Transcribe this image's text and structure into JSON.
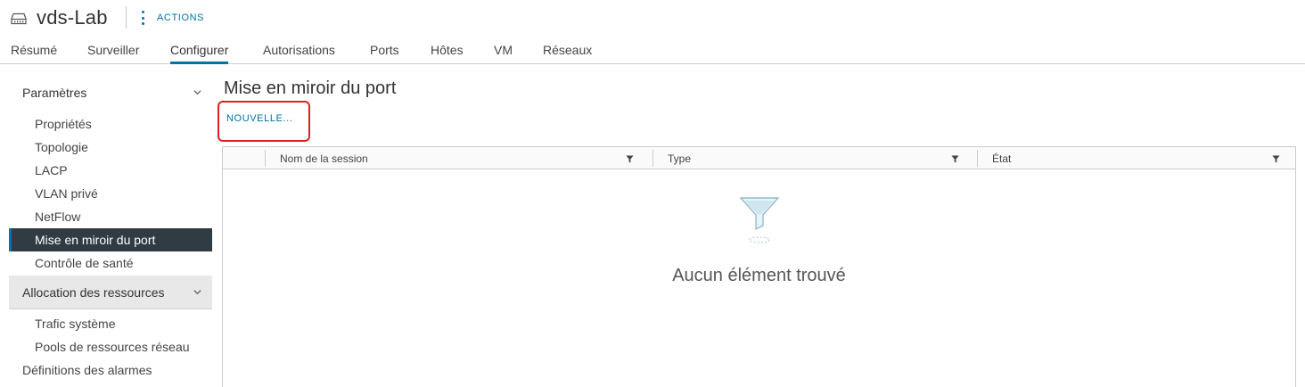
{
  "header": {
    "title": "vds-Lab",
    "object_icon": "switch-icon",
    "actions_label": "ACTIONS"
  },
  "tabs": [
    {
      "label": "Résumé"
    },
    {
      "label": "Surveiller"
    },
    {
      "label": "Configurer",
      "active": true
    },
    {
      "label": "Autorisations"
    },
    {
      "label": "Ports"
    },
    {
      "label": "Hôtes"
    },
    {
      "label": "VM"
    },
    {
      "label": "Réseaux"
    }
  ],
  "sidebar": {
    "section1": {
      "label": "Paramètres",
      "items": [
        {
          "label": "Propriétés"
        },
        {
          "label": "Topologie"
        },
        {
          "label": "LACP"
        },
        {
          "label": "VLAN privé"
        },
        {
          "label": "NetFlow"
        },
        {
          "label": "Mise en miroir du port",
          "active": true
        },
        {
          "label": "Contrôle de santé"
        }
      ]
    },
    "section2": {
      "label": "Allocation des ressources",
      "items": [
        {
          "label": "Trafic système"
        },
        {
          "label": "Pools de ressources réseau"
        }
      ]
    },
    "alarms": {
      "label": "Définitions des alarmes"
    }
  },
  "main": {
    "title": "Mise en miroir du port",
    "new_button": "NOUVELLE...",
    "columns": [
      "Nom de la session",
      "Type",
      "État"
    ],
    "empty_message": "Aucun élément trouvé"
  },
  "colors": {
    "accent": "#0072a3",
    "highlight_border": "#e02020",
    "active_item_bg": "#303b43"
  }
}
